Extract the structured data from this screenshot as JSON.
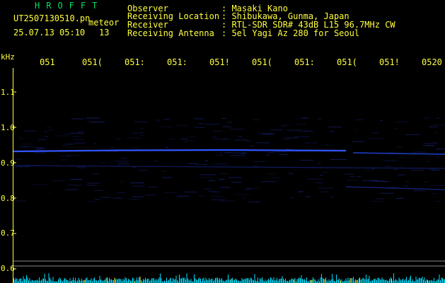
{
  "header": {
    "program": "HROFFT",
    "filename": "UT2507130510.pn",
    "meteor_label": "meteor",
    "datetime": "25.07.13 05:10",
    "count": "13",
    "info": [
      {
        "label": "Observer",
        "value": ": Masaki Kano"
      },
      {
        "label": "Receiving Location",
        "value": ": Shibukawa, Gunma, Japan"
      },
      {
        "label": "Receiver",
        "value": ": RTL-SDR SDR# 43dB L15 96.7MHz CW"
      },
      {
        "label": "Receiving Antenna",
        "value": ": 5el Yagi Az 280 for Seoul"
      }
    ]
  },
  "y_axis": {
    "unit": "kHz",
    "ticks": [
      "1.1",
      "1.0",
      "0.9",
      "0.8",
      "0.7",
      "0.6"
    ]
  },
  "x_axis": {
    "ticks": [
      "051",
      "051(",
      "051:",
      "051:",
      "051!",
      "051(",
      "051:",
      "051(",
      "051!",
      "0520"
    ]
  },
  "colors": {
    "text": "#ffff40",
    "title": "#00e060",
    "background": "#000000",
    "signal": "#3355ff",
    "noise": "#00e0ff"
  }
}
